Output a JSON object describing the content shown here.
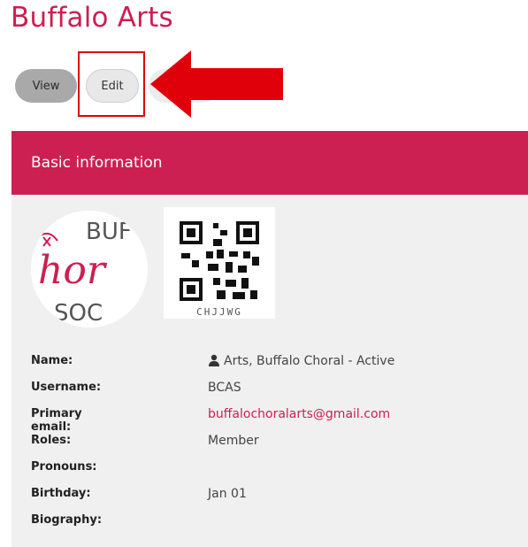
{
  "page": {
    "title": "Buffalo Arts"
  },
  "actions": {
    "view_label": "View",
    "edit_label": "Edit"
  },
  "annotation": {
    "highlight_color": "#e0000a",
    "arrow_icon": "arrow-left-icon"
  },
  "card": {
    "title": "Basic information",
    "avatar_text": {
      "top": "BUF",
      "middle": "hor",
      "bottom": "SOC"
    },
    "qr_caption": "CHJJWG",
    "fields": [
      {
        "label": "Name:",
        "value": "Arts, Buffalo Choral - Active",
        "icon": "person-icon"
      },
      {
        "label": "Username:",
        "value": "BCAS"
      },
      {
        "label": "Primary email:",
        "value": "buffalochoralarts@gmail.com",
        "is_link": true
      },
      {
        "label": "Roles:",
        "value": "Member"
      },
      {
        "label": "Pronouns:",
        "value": ""
      },
      {
        "label": "Birthday:",
        "value": "Jan 01"
      },
      {
        "label": "Biography:",
        "value": ""
      }
    ]
  },
  "colors": {
    "brand": "#cc1f52",
    "card_bg": "#f0f0f0",
    "view_button": "#a9a9a9",
    "edit_button": "#e8e8e8"
  }
}
